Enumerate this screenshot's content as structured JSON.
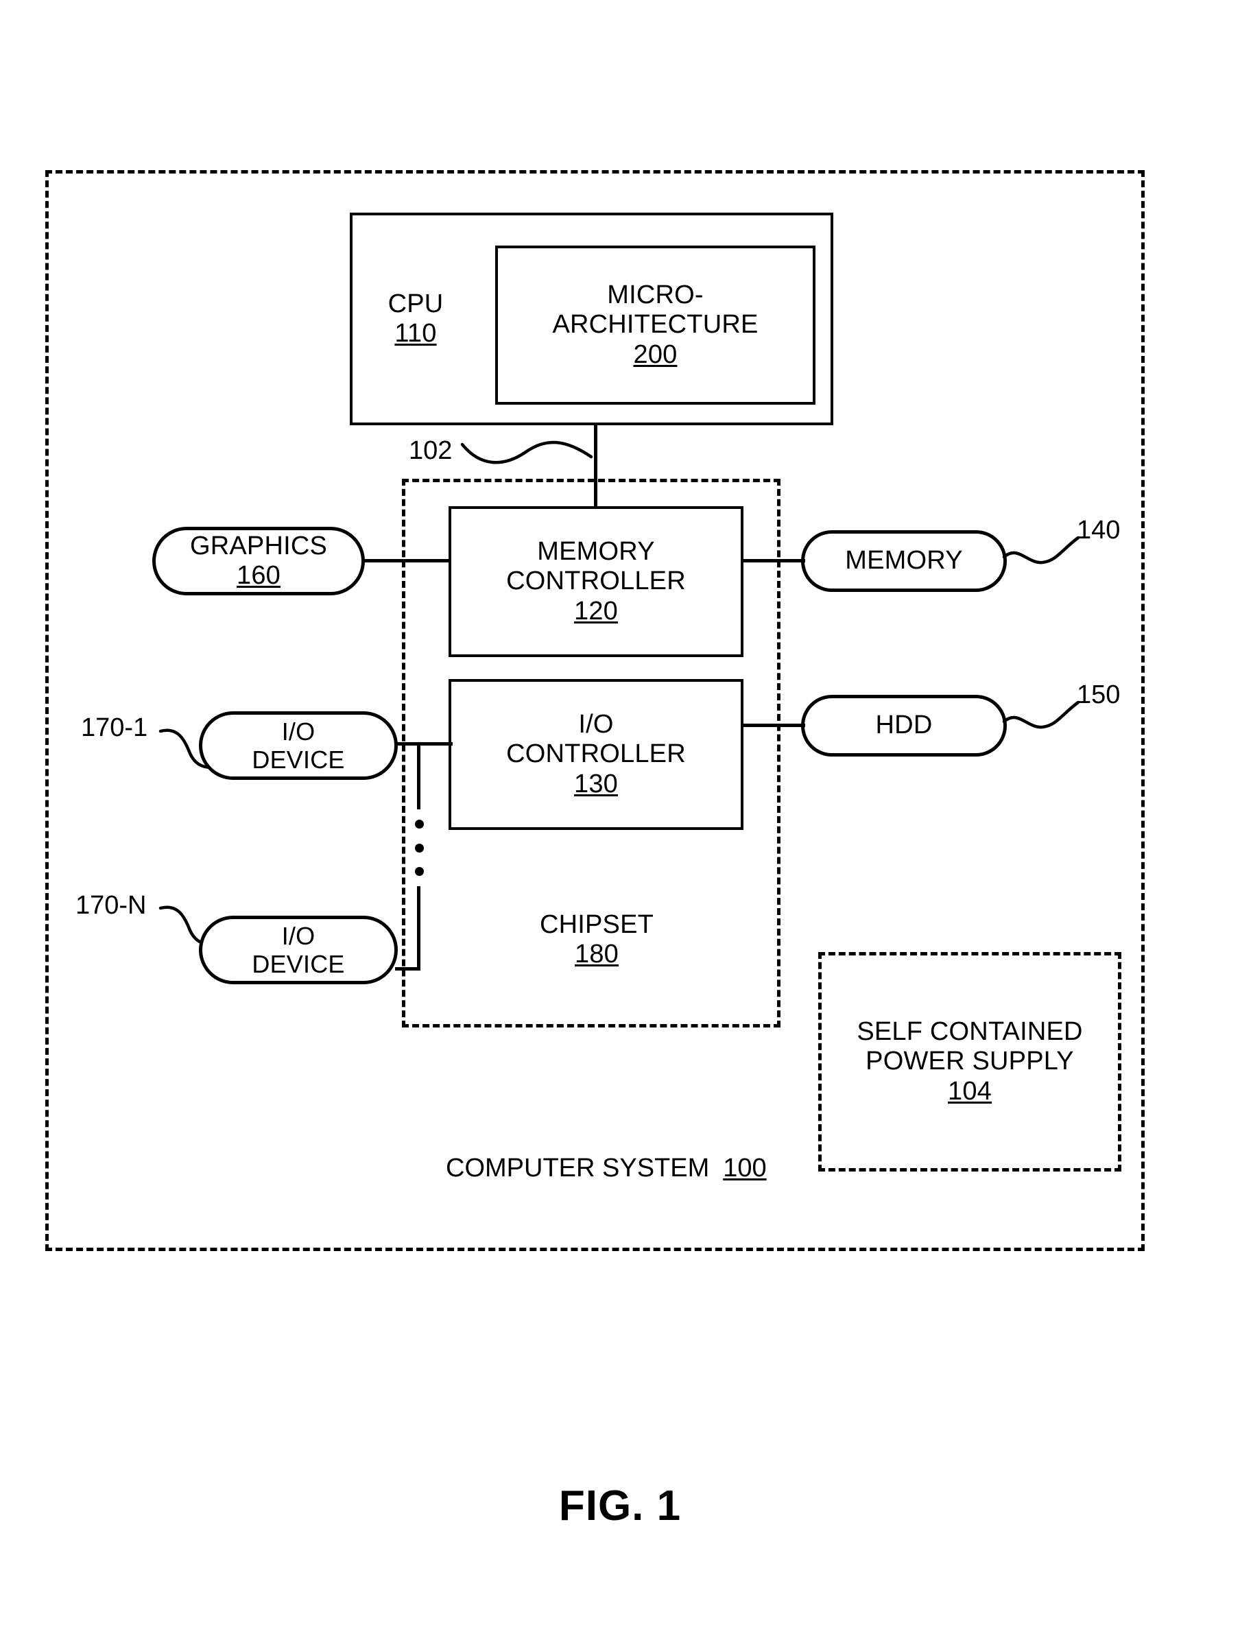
{
  "figure": {
    "caption": "FIG. 1",
    "system_label": "COMPUTER SYSTEM",
    "system_ref": "100"
  },
  "blocks": {
    "cpu": {
      "label": "CPU",
      "ref": "110"
    },
    "microarchitecture": {
      "label": "MICRO-\nARCHITECTURE",
      "line1": "MICRO-",
      "line2": "ARCHITECTURE",
      "ref": "200"
    },
    "memory_controller": {
      "line1": "MEMORY",
      "line2": "CONTROLLER",
      "ref": "120"
    },
    "io_controller": {
      "line1": "I/O",
      "line2": "CONTROLLER",
      "ref": "130"
    },
    "graphics": {
      "label": "GRAPHICS",
      "ref": "160"
    },
    "memory": {
      "label": "MEMORY",
      "ref": "140"
    },
    "hdd": {
      "label": "HDD",
      "ref": "150"
    },
    "io_device_1": {
      "line1": "I/O",
      "line2": "DEVICE",
      "ref": "170-1"
    },
    "io_device_n": {
      "line1": "I/O",
      "line2": "DEVICE",
      "ref": "170-N"
    },
    "chipset": {
      "label": "CHIPSET",
      "ref": "180"
    },
    "power_supply": {
      "line1": "SELF CONTAINED",
      "line2": "POWER SUPPLY",
      "ref": "104"
    }
  },
  "connectors": {
    "bus_ref": "102"
  },
  "colors": {
    "ink": "#000000",
    "paper": "#ffffff"
  }
}
